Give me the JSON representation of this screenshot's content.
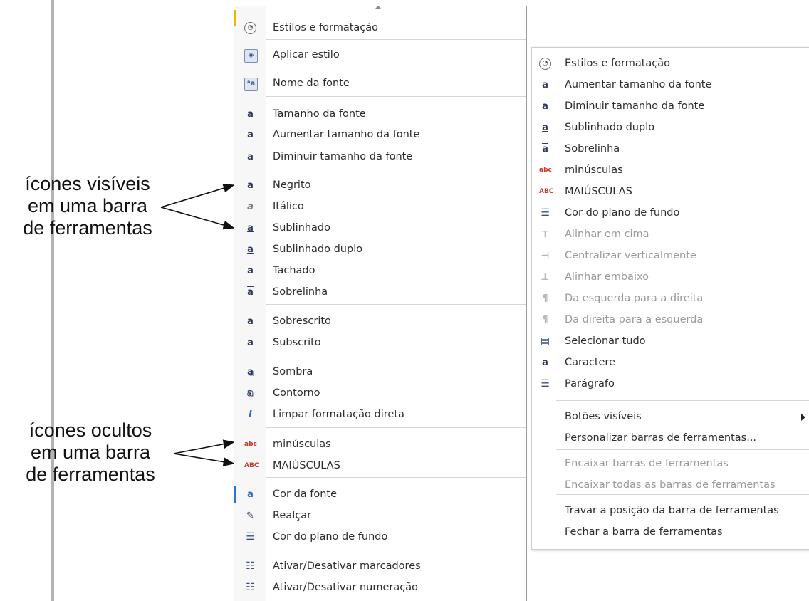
{
  "annotations": {
    "visible": [
      "ícones visíveis",
      "em uma barra",
      "de ferramentas"
    ],
    "hidden": [
      "ícones ocultos",
      "em uma barra",
      "de ferramentas"
    ]
  },
  "menu_left": {
    "items": [
      {
        "label": "Estilos e formatação",
        "icon": "styles-icon",
        "glyph": "◔"
      },
      {
        "label": "Aplicar estilo",
        "icon": "apply-style-icon",
        "glyph": "◈"
      },
      {
        "label": "Nome da fonte",
        "icon": "font-name-icon",
        "glyph": "ᵃa"
      },
      {
        "label": "Tamanho da fonte",
        "icon": "font-size-icon",
        "glyph": "a"
      },
      {
        "label": "Aumentar tamanho da fonte",
        "icon": "grow-font-icon",
        "glyph": "a"
      },
      {
        "label": "Diminuir tamanho da fonte",
        "icon": "shrink-font-icon",
        "glyph": "a"
      },
      {
        "label": "Negrito",
        "icon": "bold-icon",
        "glyph": "a"
      },
      {
        "label": "Itálico",
        "icon": "italic-icon",
        "glyph": "a"
      },
      {
        "label": "Sublinhado",
        "icon": "underline-icon",
        "glyph": "a"
      },
      {
        "label": "Sublinhado duplo",
        "icon": "double-underline-icon",
        "glyph": "a"
      },
      {
        "label": "Tachado",
        "icon": "strikethrough-icon",
        "glyph": "a"
      },
      {
        "label": "Sobrelinha",
        "icon": "overline-icon",
        "glyph": "a"
      },
      {
        "label": "Sobrescrito",
        "icon": "superscript-icon",
        "glyph": "a"
      },
      {
        "label": "Subscrito",
        "icon": "subscript-icon",
        "glyph": "a"
      },
      {
        "label": "Sombra",
        "icon": "shadow-icon",
        "glyph": "a"
      },
      {
        "label": "Contorno",
        "icon": "outline-icon",
        "glyph": "a"
      },
      {
        "label": "Limpar formatação direta",
        "icon": "clear-formatting-icon",
        "glyph": "I"
      },
      {
        "label": "minúsculas",
        "icon": "lowercase-icon",
        "glyph": "abc"
      },
      {
        "label": "MAIÚSCULAS",
        "icon": "uppercase-icon",
        "glyph": "ABC"
      },
      {
        "label": "Cor da fonte",
        "icon": "font-color-icon",
        "glyph": "a"
      },
      {
        "label": "Realçar",
        "icon": "highlight-icon",
        "glyph": "✎"
      },
      {
        "label": "Cor do plano de fundo",
        "icon": "background-color-icon",
        "glyph": "☰"
      },
      {
        "label": "Ativar/Desativar marcadores",
        "icon": "bullets-icon",
        "glyph": "☷"
      },
      {
        "label": "Ativar/Desativar numeração",
        "icon": "numbering-icon",
        "glyph": "☷"
      }
    ]
  },
  "menu_right": {
    "items": [
      {
        "label": "Estilos e formatação",
        "icon": "styles-icon",
        "glyph": "◔",
        "disabled": false
      },
      {
        "label": "Aumentar tamanho da fonte",
        "icon": "grow-font-icon",
        "glyph": "a",
        "disabled": false
      },
      {
        "label": "Diminuir tamanho da fonte",
        "icon": "shrink-font-icon",
        "glyph": "a",
        "disabled": false
      },
      {
        "label": "Sublinhado duplo",
        "icon": "double-underline-icon",
        "glyph": "a",
        "disabled": false
      },
      {
        "label": "Sobrelinha",
        "icon": "overline-icon",
        "glyph": "a",
        "disabled": false
      },
      {
        "label": "minúsculas",
        "icon": "lowercase-icon",
        "glyph": "abc",
        "disabled": false
      },
      {
        "label": "MAIÚSCULAS",
        "icon": "uppercase-icon",
        "glyph": "ABC",
        "disabled": false
      },
      {
        "label": "Cor do plano de fundo",
        "icon": "background-color-icon",
        "glyph": "☰",
        "disabled": false
      },
      {
        "label": "Alinhar em cima",
        "icon": "align-top-icon",
        "glyph": "⊤",
        "disabled": true
      },
      {
        "label": "Centralizar verticalmente",
        "icon": "align-middle-icon",
        "glyph": "⊣",
        "disabled": true
      },
      {
        "label": "Alinhar embaixo",
        "icon": "align-bottom-icon",
        "glyph": "⊥",
        "disabled": true
      },
      {
        "label": "Da esquerda para a direita",
        "icon": "ltr-icon",
        "glyph": "¶",
        "disabled": true
      },
      {
        "label": "Da direita para a esquerda",
        "icon": "rtl-icon",
        "glyph": "¶",
        "disabled": true
      },
      {
        "label": "Selecionar tudo",
        "icon": "select-all-icon",
        "glyph": "▤",
        "disabled": false
      },
      {
        "label": "Caractere",
        "icon": "character-icon",
        "glyph": "a",
        "disabled": false
      },
      {
        "label": "Parágrafo",
        "icon": "paragraph-icon",
        "glyph": "☰",
        "disabled": false
      }
    ],
    "options": [
      {
        "label": "Botões visíveis",
        "disabled": false,
        "submenu": true
      },
      {
        "label": "Personalizar barras de ferramentas...",
        "disabled": false,
        "submenu": false
      },
      {
        "label": "Encaixar barras de ferramentas",
        "disabled": true,
        "submenu": false
      },
      {
        "label": "Encaixar todas as barras de ferramentas",
        "disabled": true,
        "submenu": false
      },
      {
        "label": "Travar a posição da barra de ferramentas",
        "disabled": false,
        "submenu": false
      },
      {
        "label": "Fechar a barra de ferramentas",
        "disabled": false,
        "submenu": false
      }
    ]
  }
}
